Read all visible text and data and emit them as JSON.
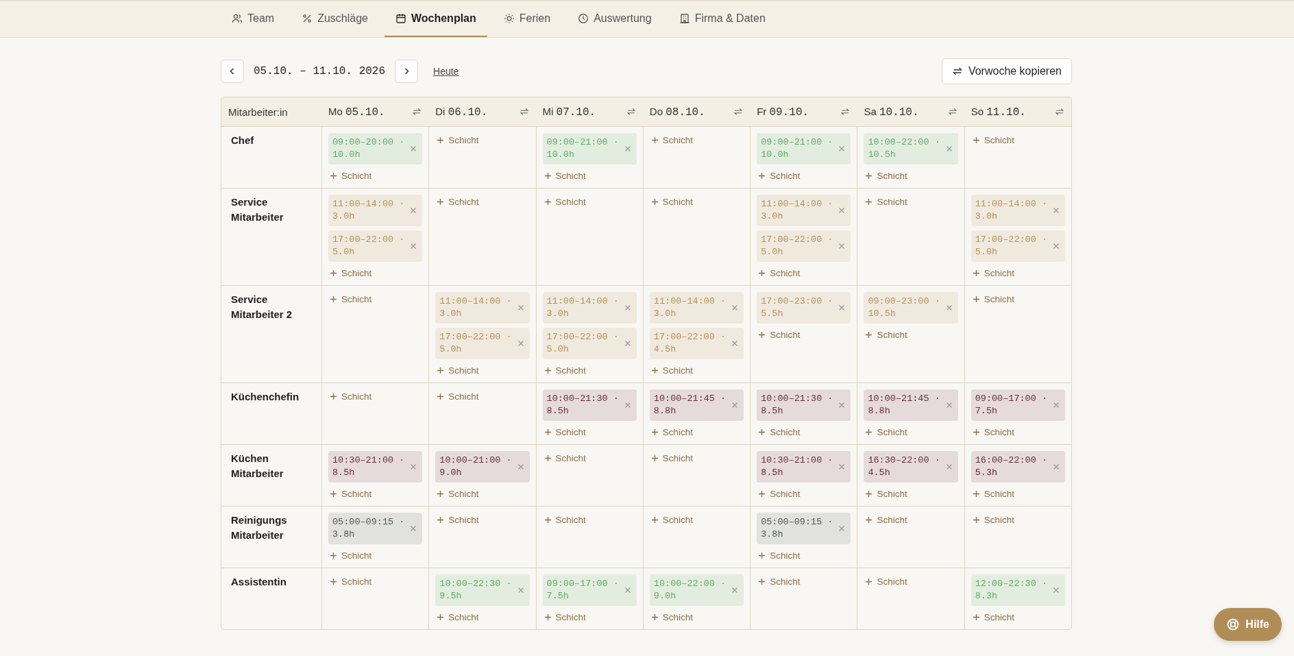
{
  "nav": {
    "tabs": [
      {
        "label": "Team",
        "selected": false
      },
      {
        "label": "Zuschläge",
        "selected": false
      },
      {
        "label": "Wochenplan",
        "selected": true
      },
      {
        "label": "Ferien",
        "selected": false
      },
      {
        "label": "Auswertung",
        "selected": false
      },
      {
        "label": "Firma & Daten",
        "selected": false
      }
    ]
  },
  "toolbar": {
    "range": "05.10. – 11.10. 2026",
    "today_link": "Heute",
    "copy_button": "Vorwoche kopieren"
  },
  "table": {
    "first_column": "Mitarbeiter:in",
    "days": [
      {
        "weekday": "Mo",
        "date": "05.10."
      },
      {
        "weekday": "Di",
        "date": "06.10."
      },
      {
        "weekday": "Mi",
        "date": "07.10."
      },
      {
        "weekday": "Do",
        "date": "08.10."
      },
      {
        "weekday": "Fr",
        "date": "09.10."
      },
      {
        "weekday": "Sa",
        "date": "10.10."
      },
      {
        "weekday": "So",
        "date": "11.10."
      }
    ],
    "rows": [
      {
        "name": "Chef",
        "color": "#5eae64",
        "cells": [
          {
            "shifts": [
              "09:00–20:00 · 10.0h"
            ],
            "add_label": "Schicht"
          },
          {
            "add_label": "Schicht"
          },
          {
            "shifts": [
              "09:00–21:00 · 10.0h"
            ],
            "add_label": "Schicht"
          },
          {
            "add_label": "Schicht"
          },
          {
            "shifts": [
              "09:00–21:00 · 10.0h"
            ],
            "add_label": "Schicht"
          },
          {
            "shifts": [
              "10:00–22:00 · 10.5h"
            ],
            "add_label": "Schicht"
          },
          {
            "add_label": "Schicht"
          }
        ]
      },
      {
        "name": "Service Mitarbeiter",
        "color": "#b8935a",
        "cells": [
          {
            "shifts": [
              "11:00–14:00 · 3.0h",
              "17:00–22:00 · 5.0h"
            ],
            "add_label": "Schicht"
          },
          {
            "add_label": "Schicht"
          },
          {
            "add_label": "Schicht"
          },
          {
            "add_label": "Schicht"
          },
          {
            "shifts": [
              "11:00–14:00 · 3.0h",
              "17:00–22:00 · 5.0h"
            ],
            "add_label": "Schicht"
          },
          {
            "add_label": "Schicht"
          },
          {
            "shifts": [
              "11:00–14:00 · 3.0h",
              "17:00–22:00 · 5.0h"
            ],
            "add_label": "Schicht"
          }
        ]
      },
      {
        "name": "Service Mitarbeiter 2",
        "color": "#b8935a",
        "cells": [
          {
            "add_label": "Schicht"
          },
          {
            "shifts": [
              "11:00–14:00 · 3.0h",
              "17:00–22:00 · 5.0h"
            ],
            "add_label": "Schicht"
          },
          {
            "shifts": [
              "11:00–14:00 · 3.0h",
              "17:00–22:00 · 5.0h"
            ],
            "add_label": "Schicht"
          },
          {
            "shifts": [
              "11:00–14:00 · 3.0h",
              "17:00–22:00 · 4.5h"
            ],
            "add_label": "Schicht"
          },
          {
            "shifts": [
              "17:00–23:00 · 5.5h"
            ],
            "add_label": "Schicht"
          },
          {
            "shifts": [
              "09:00–23:00 · 10.5h"
            ],
            "add_label": "Schicht"
          },
          {
            "add_label": "Schicht"
          }
        ]
      },
      {
        "name": "Küchenchefin",
        "color": "#6b2d3f",
        "cells": [
          {
            "add_label": "Schicht"
          },
          {
            "add_label": "Schicht"
          },
          {
            "shifts": [
              "10:00–21:30 · 8.5h"
            ],
            "add_label": "Schicht"
          },
          {
            "shifts": [
              "10:00–21:45 · 8.8h"
            ],
            "add_label": "Schicht"
          },
          {
            "shifts": [
              "10:00–21:30 · 8.5h"
            ],
            "add_label": "Schicht"
          },
          {
            "shifts": [
              "10:00–21:45 · 8.8h"
            ],
            "add_label": "Schicht"
          },
          {
            "shifts": [
              "09:00–17:00 · 7.5h"
            ],
            "add_label": "Schicht"
          }
        ]
      },
      {
        "name": "Küchen Mitarbeiter",
        "color": "#6b2d3f",
        "cells": [
          {
            "shifts": [
              "10:30–21:00 · 8.5h"
            ],
            "add_label": "Schicht"
          },
          {
            "shifts": [
              "10:00–21:00 · 9.0h"
            ],
            "add_label": "Schicht"
          },
          {
            "add_label": "Schicht"
          },
          {
            "add_label": "Schicht"
          },
          {
            "shifts": [
              "10:30–21:00 · 8.5h"
            ],
            "add_label": "Schicht"
          },
          {
            "shifts": [
              "16:30–22:00 · 4.5h"
            ],
            "add_label": "Schicht"
          },
          {
            "shifts": [
              "16:00–22:00 · 5.3h"
            ],
            "add_label": "Schicht"
          }
        ]
      },
      {
        "name": "Reinigungs Mitarbeiter",
        "color": "#4f5b5b",
        "cells": [
          {
            "shifts": [
              "05:00–09:15 · 3.8h"
            ],
            "add_label": "Schicht"
          },
          {
            "add_label": "Schicht"
          },
          {
            "add_label": "Schicht"
          },
          {
            "add_label": "Schicht"
          },
          {
            "shifts": [
              "05:00–09:15 · 3.8h"
            ],
            "add_label": "Schicht"
          },
          {
            "add_label": "Schicht"
          },
          {
            "add_label": "Schicht"
          }
        ]
      },
      {
        "name": "Assistentin",
        "color": "#5eae64",
        "cells": [
          {
            "add_label": "Schicht"
          },
          {
            "shifts": [
              "10:00–22:30 · 9.5h"
            ],
            "add_label": "Schicht"
          },
          {
            "shifts": [
              "09:00–17:00 · 7.5h"
            ],
            "add_label": "Schicht"
          },
          {
            "shifts": [
              "10:00–22:00 · 9.0h"
            ],
            "add_label": "Schicht"
          },
          {
            "add_label": "Schicht"
          },
          {
            "add_label": "Schicht"
          },
          {
            "shifts": [
              "12:00–22:30 · 8.3h"
            ],
            "add_label": "Schicht"
          }
        ]
      }
    ]
  },
  "help_button": "Hilfe"
}
